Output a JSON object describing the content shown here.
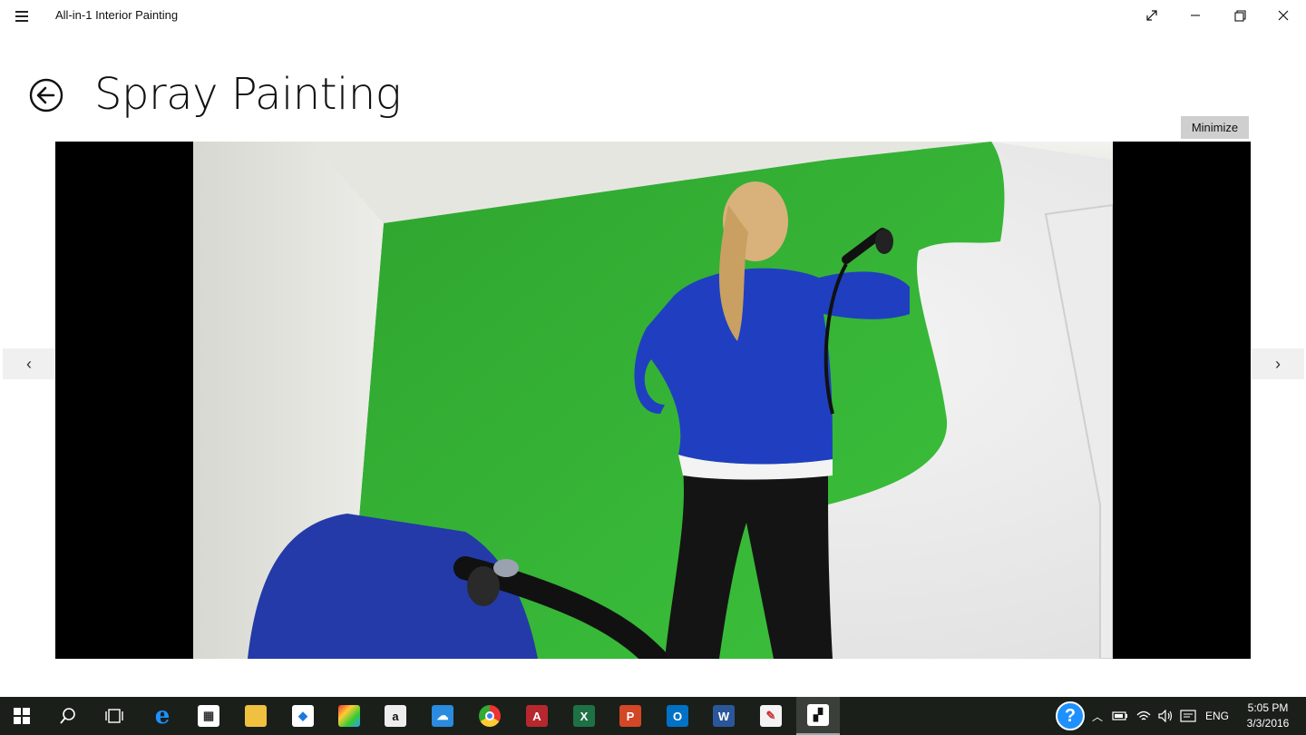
{
  "window": {
    "app_title": "All-in-1 Interior Painting",
    "controls": [
      "fullscreen-icon",
      "minimize-icon",
      "restore-icon",
      "close-icon"
    ]
  },
  "header": {
    "title": "Spray Painting",
    "minimize_label": "Minimize"
  },
  "media": {
    "description_icon": "video-frame",
    "prev_label": "‹",
    "next_label": "›"
  },
  "taskbar": {
    "apps": [
      "start-icon",
      "search-icon",
      "task-view-icon",
      "edge-icon",
      "store-icon",
      "file-explorer-icon",
      "dropbox-icon",
      "photos-icon",
      "amazon-icon",
      "onedrive-icon",
      "chrome-icon",
      "access-icon",
      "excel-icon",
      "powerpoint-icon",
      "outlook-icon",
      "word-icon",
      "paint-icon",
      "interior-painting-icon"
    ],
    "tray": {
      "language": "ENG",
      "time": "5:05 PM",
      "date": "3/3/2016"
    }
  },
  "colors": {
    "accent_green": "#3fbf3f",
    "taskbar_bg": "#1a1f1a",
    "help_blue": "#1e90ff"
  }
}
